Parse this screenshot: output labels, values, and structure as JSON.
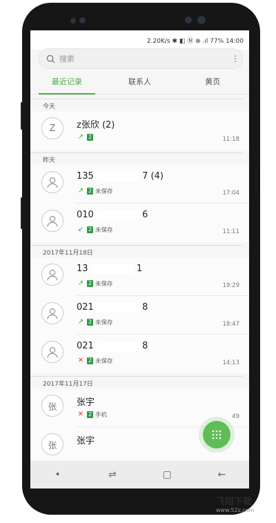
{
  "status_bar": {
    "text": "2.20K/s ✱ ◧ Ⓝ ⊗ .ıl 77% 14:00"
  },
  "search": {
    "placeholder": "搜索"
  },
  "tabs": [
    {
      "label": "最近记录",
      "active": true
    },
    {
      "label": "联系人",
      "active": false
    },
    {
      "label": "黄页",
      "active": false
    }
  ],
  "sections": [
    {
      "title": "今天"
    },
    {
      "title": "昨天"
    },
    {
      "title": "2017年11月18日"
    },
    {
      "title": "2017年11月17日"
    }
  ],
  "calls": [
    {
      "avatar": "Z",
      "name_prefix": "z张欣 (2)",
      "name_suffix": "",
      "masked": false,
      "call_type": "outgoing",
      "sim": "2",
      "note": "",
      "time": "11:18"
    },
    {
      "avatar": "",
      "name_prefix": "135",
      "name_suffix": "7 (4)",
      "masked": true,
      "call_type": "outgoing",
      "sim": "2",
      "note": "未保存",
      "time": "17:04"
    },
    {
      "avatar": "",
      "name_prefix": "010",
      "name_suffix": "6",
      "masked": true,
      "call_type": "incoming",
      "sim": "2",
      "note": "未保存",
      "time": "11:11"
    },
    {
      "avatar": "",
      "name_prefix": "13",
      "name_suffix": "1",
      "masked": true,
      "call_type": "outgoing",
      "sim": "2",
      "note": "未保存",
      "time": "19:29"
    },
    {
      "avatar": "",
      "name_prefix": "021",
      "name_suffix": "8",
      "masked": true,
      "call_type": "outgoing",
      "sim": "2",
      "note": "未保存",
      "time": "18:47"
    },
    {
      "avatar": "",
      "name_prefix": "021",
      "name_suffix": "8",
      "masked": true,
      "call_type": "missed",
      "sim": "2",
      "note": "未保存",
      "time": "14:13"
    },
    {
      "avatar": "张",
      "name_prefix": "张宇",
      "name_suffix": "",
      "masked": false,
      "call_type": "missed",
      "sim": "2",
      "note": "手机",
      "time": "49"
    },
    {
      "avatar": "张",
      "name_prefix": "张宇",
      "name_suffix": "",
      "masked": false,
      "call_type": "missed",
      "sim": "2",
      "note": "",
      "time": ""
    }
  ],
  "icons": {
    "search": "search-icon",
    "more": "more-vertical-icon",
    "contact": "person-icon",
    "outgoing": "outgoing-call-icon",
    "incoming": "incoming-call-icon",
    "missed": "missed-call-icon",
    "dialpad": "dialpad-icon"
  },
  "colors": {
    "accent": "#4cab45",
    "sim": "#2f9a46",
    "missed": "#e53935",
    "fab": "#5fbd57"
  },
  "watermark": {
    "title": "飞翔下载",
    "url": "www.52z.com"
  }
}
